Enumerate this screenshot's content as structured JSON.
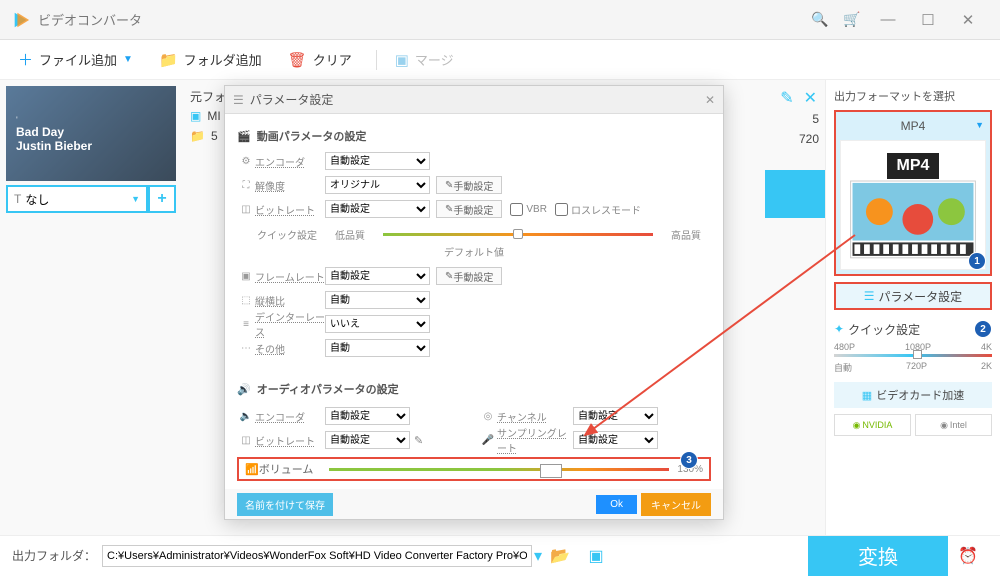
{
  "titlebar": {
    "title": "ビデオコンバータ"
  },
  "toolbar": {
    "add_file": "ファイル追加",
    "add_folder": "フォルダ追加",
    "clear": "クリア",
    "merge": "マージ"
  },
  "thumb": {
    "line1": "Bad Day",
    "line2": "Justin Bieber"
  },
  "tabs": {
    "none": "なし",
    "plus": "+"
  },
  "filelist": {
    "header": "元フォ",
    "row1": "MI",
    "row2": "5",
    "res_a": "5",
    "res_b": "720"
  },
  "dialog": {
    "title": "パラメータ設定",
    "video_section": "動画パラメータの設定",
    "encoder": "エンコーダ",
    "resolution": "解像度",
    "bitrate": "ビットレート",
    "quick": "クイック設定",
    "low": "低品質",
    "default": "デフォルト値",
    "high": "高品質",
    "framerate": "フレームレート",
    "aspect": "縦横比",
    "deinterlace": "デインターレース",
    "other": "その他",
    "auto": "自動設定",
    "original": "オリジナル",
    "auto2": "自動",
    "no": "いいえ",
    "manual": "手動設定",
    "vbr": "VBR",
    "lossless": "ロスレスモード",
    "audio_section": "オーディオパラメータの設定",
    "a_encoder": "エンコーダ",
    "a_bitrate": "ビットレート",
    "a_channel": "チャンネル",
    "a_samplerate": "サンプリングレート",
    "volume": "ボリューム",
    "volume_pct": "130%",
    "save_as": "名前を付けて保存",
    "ok": "Ok",
    "cancel": "キャンセル"
  },
  "right": {
    "header": "出力フォーマットを選択",
    "format": "MP4",
    "param_settings": "パラメータ設定",
    "quick_settings": "クイック設定",
    "scale": [
      "480P",
      "1080P",
      "4K"
    ],
    "scale2": [
      "自動",
      "720P",
      "2K"
    ],
    "gpu": "ビデオカード加速",
    "nvidia": "NVIDIA",
    "intel": "Intel"
  },
  "bottom": {
    "label": "出力フォルダ：",
    "path": "C:¥Users¥Administrator¥Videos¥WonderFox Soft¥HD Video Converter Factory Pro¥OutputVideo¥",
    "convert": "変換"
  },
  "annotations": {
    "n1": "1",
    "n2": "2",
    "n3": "3"
  }
}
